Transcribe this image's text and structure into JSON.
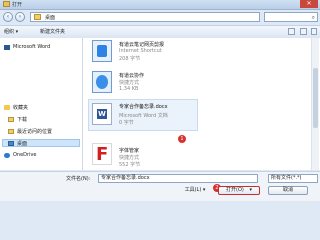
{
  "window": {
    "title": "打开"
  },
  "address": {
    "path": "桌面",
    "search_placeholder": "搜索 桌面"
  },
  "toolbar": {
    "organize": "组织 ▾",
    "new_folder": "新建文件夹"
  },
  "nav": {
    "items": [
      {
        "label": "Microsoft Word",
        "icon": "word-icon"
      },
      {
        "label": "收藏夹",
        "icon": "star-icon"
      },
      {
        "label": "下载",
        "icon": "folder-icon"
      },
      {
        "label": "最近访问的位置",
        "icon": "folder-icon"
      },
      {
        "label": "桌面",
        "icon": "desktop-icon"
      },
      {
        "label": "OneDrive",
        "icon": "cloud-icon"
      }
    ]
  },
  "files": [
    {
      "name": "有道云笔记网页剪报",
      "type": "Internet Shortcut",
      "size": "208 字节",
      "icon": "note-icon"
    },
    {
      "name": "有道云协作",
      "type": "快捷方式",
      "size": "1.34 KB",
      "icon": "collab-icon"
    },
    {
      "name": "专家合作备忘录.docx",
      "type": "Microsoft Word 文档",
      "size": "0 字节",
      "icon": "word-doc-icon"
    },
    {
      "name": "字体管家",
      "type": "快捷方式",
      "size": "552 字节",
      "icon": "font-manager-icon"
    }
  ],
  "badges": {
    "one": "1",
    "two": "2"
  },
  "bottom": {
    "filename_label": "文件名(N):",
    "filename_value": "专家合作备忘录.docx",
    "filetype_value": "所有文件(*.*)",
    "tools_label": "工具(L) ▾",
    "open_label": "打开(O)",
    "open_arrow": "▾",
    "cancel_label": "取消"
  }
}
